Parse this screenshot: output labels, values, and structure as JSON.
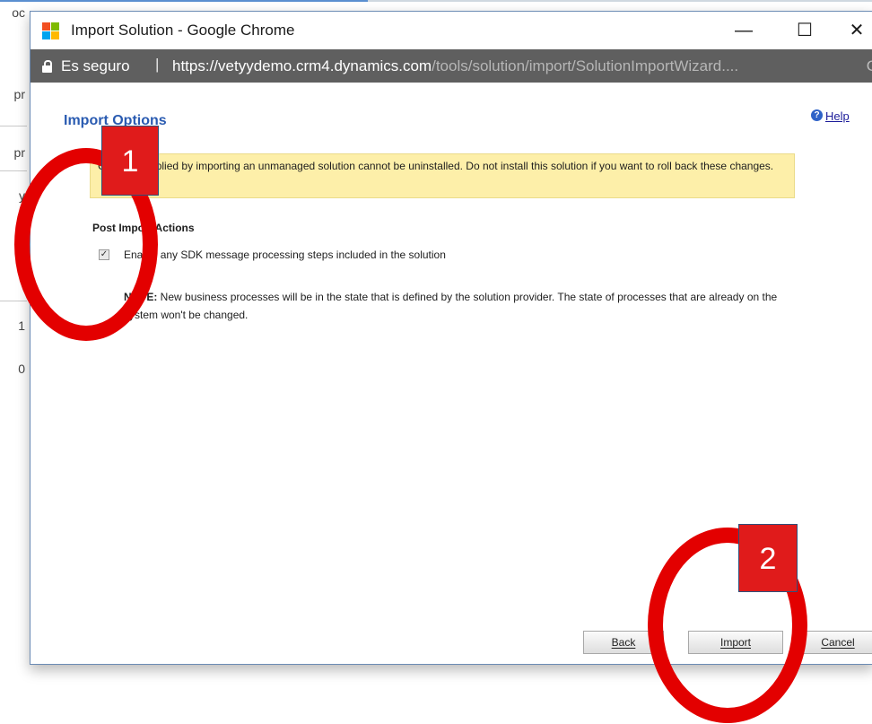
{
  "background": {
    "fragments": [
      "oc",
      "pr",
      "y",
      "1",
      "0"
    ]
  },
  "window": {
    "title": "Import Solution - Google Chrome",
    "controls": {
      "minimize": "—",
      "maximize": "☐",
      "close": "✕"
    },
    "icon": "windows-app-icon"
  },
  "address_bar": {
    "secure_label": "Es seguro",
    "separator": "|",
    "url_host": "https://vetyydemo.crm4.dynamics.com",
    "url_path": "/tools/solution/import/SolutionImportWizard....",
    "trailing": "G",
    "icon": "lock-icon"
  },
  "page": {
    "heading": "Import Options",
    "help_label": "Help",
    "help_icon_glyph": "?",
    "warning_text": "Changes applied by importing an unmanaged solution cannot be uninstalled. Do not install this solution if you want to roll back these changes.",
    "section_title": "Post Import Actions",
    "checkbox_checked": true,
    "checkbox_label": "Enable any SDK message processing steps included in the solution",
    "note_label": "NOTE:",
    "note_text": " New business processes will be in the state that is defined by the solution provider. The state of processes that are already on the system won't be changed."
  },
  "buttons": {
    "back": "Back",
    "import": "Import",
    "cancel": "Cancel"
  },
  "annotations": {
    "marker1": "1",
    "marker2": "2",
    "color": "#e30000"
  },
  "colors": {
    "heading": "#2a5bb1",
    "address_bar_bg": "#5f5f5f",
    "warning_bg": "#fdefa9"
  }
}
